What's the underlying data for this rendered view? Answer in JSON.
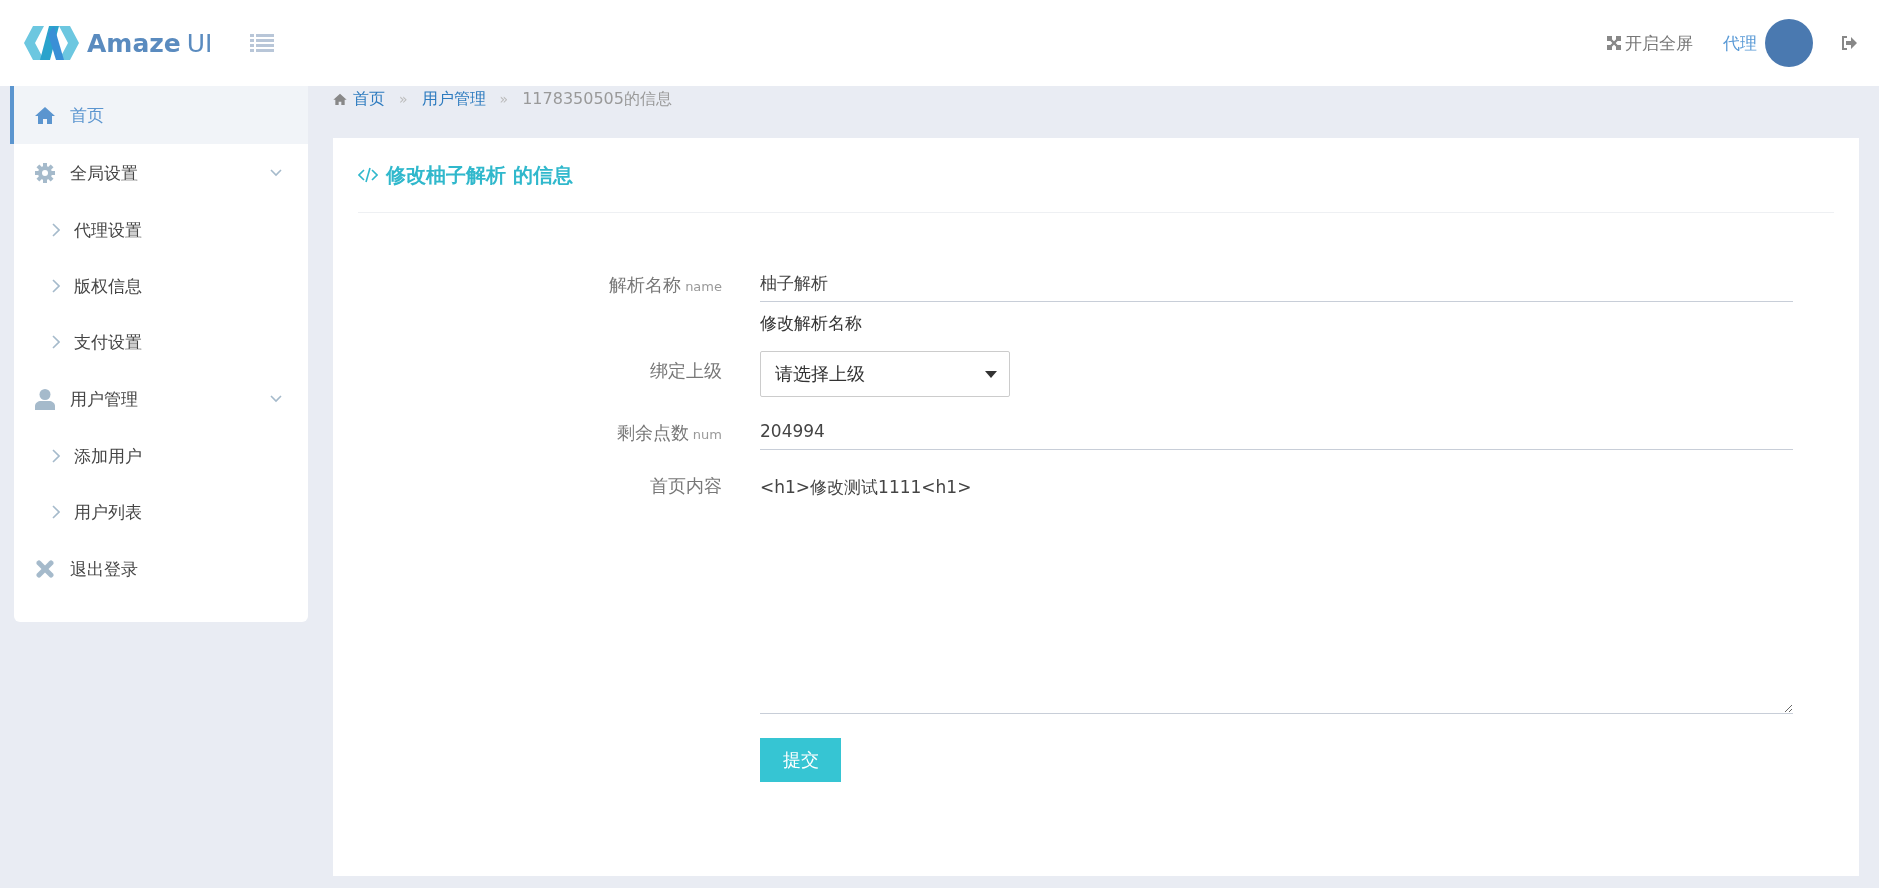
{
  "header": {
    "logo": {
      "name": "Amaze",
      "suffix": "UI"
    },
    "fullscreen": "开启全屏",
    "user": "代理"
  },
  "sidebar": {
    "items": [
      {
        "kind": "home",
        "label": "首页",
        "selected": true
      },
      {
        "kind": "settings",
        "label": "全局设置",
        "selected": false,
        "expanded": true,
        "children": [
          {
            "label": "代理设置",
            "selected": false
          },
          {
            "label": "版权信息",
            "selected": false
          },
          {
            "label": "支付设置",
            "selected": false
          }
        ]
      },
      {
        "kind": "user",
        "label": "用户管理",
        "selected": false,
        "expanded": true,
        "children": [
          {
            "label": "添加用户",
            "selected": false
          },
          {
            "label": "用户列表",
            "selected": false
          }
        ]
      },
      {
        "kind": "logout",
        "label": "退出登录",
        "selected": false
      }
    ]
  },
  "breadcrumb": [
    {
      "kind": "link",
      "label": "首页"
    },
    {
      "kind": "link",
      "label": "用户管理",
      "separator": "»"
    },
    {
      "kind": "current",
      "label": "1178350505的信息",
      "separator": "»"
    }
  ],
  "form": {
    "title": "修改柚子解析 的信息",
    "fields": [
      {
        "kind": "text",
        "label": "解析名称",
        "hint": "name",
        "value": "柚子解析",
        "help": "修改解析名称"
      },
      {
        "kind": "select",
        "label": "绑定上级",
        "value": "请选择上级"
      },
      {
        "kind": "text",
        "label": "剩余点数",
        "hint": "num",
        "value": "204994"
      },
      {
        "kind": "textarea",
        "label": "首页内容",
        "value": "<h1>修改测试1111<h1>"
      }
    ],
    "submit": "提交"
  }
}
